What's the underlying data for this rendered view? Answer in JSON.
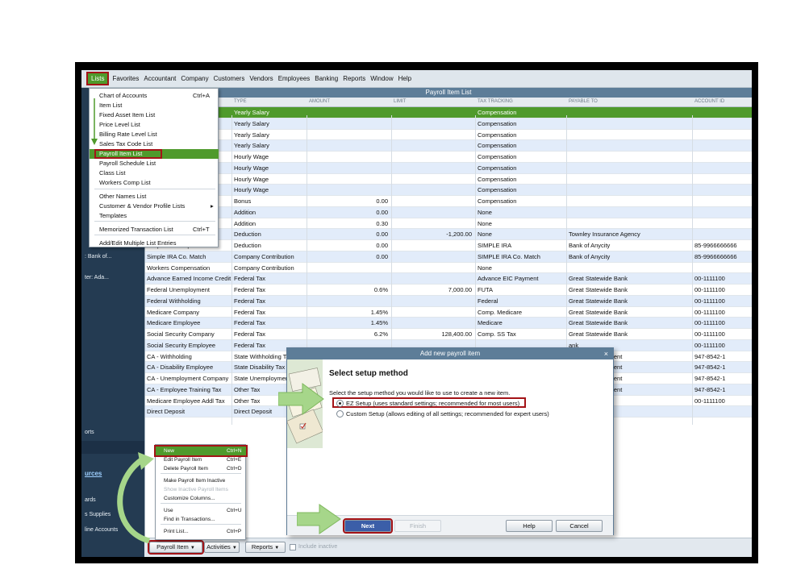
{
  "menubar": [
    "Lists",
    "Favorites",
    "Accountant",
    "Company",
    "Customers",
    "Vendors",
    "Employees",
    "Banking",
    "Reports",
    "Window",
    "Help"
  ],
  "lists_menu": {
    "items": [
      {
        "label": "Chart of Accounts",
        "shortcut": "Ctrl+A"
      },
      {
        "label": "Item List",
        "shortcut": ""
      },
      {
        "label": "Fixed Asset Item List",
        "shortcut": ""
      },
      {
        "label": "Price Level List",
        "shortcut": ""
      },
      {
        "label": "Billing Rate Level List",
        "shortcut": ""
      },
      {
        "label": "Sales Tax Code List",
        "shortcut": ""
      },
      {
        "label": "Payroll Item List",
        "shortcut": ""
      },
      {
        "label": "Payroll Schedule List",
        "shortcut": ""
      },
      {
        "label": "Class List",
        "shortcut": ""
      },
      {
        "label": "Workers Comp List",
        "shortcut": ""
      },
      {
        "label": "Other Names List",
        "shortcut": ""
      },
      {
        "label": "Customer & Vendor Profile Lists",
        "shortcut": ""
      },
      {
        "label": "Templates",
        "shortcut": ""
      },
      {
        "label": "Memorized Transaction List",
        "shortcut": "Ctrl+T"
      },
      {
        "label": "Add/Edit Multiple List Entries",
        "shortcut": ""
      }
    ],
    "submenu_arrow": "▸"
  },
  "nav": {
    "text1": ": Bank of...",
    "text2": "ter: Ada...",
    "text3": "orts",
    "link": "urces",
    "text4": "ards",
    "text5": "s Supplies",
    "text6": "line Accounts"
  },
  "payroll_list": {
    "title": "Payroll Item List",
    "columns": [
      "TYPE",
      "AMOUNT",
      "LIMIT",
      "TAX TRACKING",
      "PAYABLE TO",
      "ACCOUNT ID"
    ],
    "rows": [
      [
        "",
        "Yearly Salary",
        "",
        "",
        "Compensation",
        "",
        ""
      ],
      [
        "",
        "Yearly Salary",
        "",
        "",
        "Compensation",
        "",
        ""
      ],
      [
        "",
        "Yearly Salary",
        "",
        "",
        "Compensation",
        "",
        ""
      ],
      [
        "",
        "Yearly Salary",
        "",
        "",
        "Compensation",
        "",
        ""
      ],
      [
        "",
        "Hourly Wage",
        "",
        "",
        "Compensation",
        "",
        ""
      ],
      [
        "",
        "Hourly Wage",
        "",
        "",
        "Compensation",
        "",
        ""
      ],
      [
        "",
        "Hourly Wage",
        "",
        "",
        "Compensation",
        "",
        ""
      ],
      [
        "",
        "Hourly Wage",
        "",
        "",
        "Compensation",
        "",
        ""
      ],
      [
        "",
        "Bonus",
        "0.00",
        "",
        "Compensation",
        "",
        ""
      ],
      [
        "",
        "Addition",
        "0.00",
        "",
        "None",
        "",
        ""
      ],
      [
        "",
        "Addition",
        "0.30",
        "",
        "None",
        "",
        ""
      ],
      [
        "",
        "Deduction",
        "0.00",
        "-1,200.00",
        "None",
        "Townley Insurance Agency",
        ""
      ],
      [
        "Simple IRA Emp.",
        "Deduction",
        "0.00",
        "",
        "SIMPLE IRA",
        "Bank of Anycity",
        "85-9966666666"
      ],
      [
        "Simple IRA Co. Match",
        "Company Contribution",
        "0.00",
        "",
        "SIMPLE IRA Co. Match",
        "Bank of Anycity",
        "85-9966666666"
      ],
      [
        "Workers Compensation",
        "Company Contribution",
        "",
        "",
        "None",
        "",
        ""
      ],
      [
        "Advance Earned Income Credit",
        "Federal Tax",
        "",
        "",
        "Advance EIC Payment",
        "Great Statewide Bank",
        "00-1111100"
      ],
      [
        "Federal Unemployment",
        "Federal Tax",
        "0.6%",
        "7,000.00",
        "FUTA",
        "Great Statewide Bank",
        "00-1111100"
      ],
      [
        "Federal Withholding",
        "Federal Tax",
        "",
        "",
        "Federal",
        "Great Statewide Bank",
        "00-1111100"
      ],
      [
        "Medicare Company",
        "Federal Tax",
        "1.45%",
        "",
        "Comp. Medicare",
        "Great Statewide Bank",
        "00-1111100"
      ],
      [
        "Medicare Employee",
        "Federal Tax",
        "1.45%",
        "",
        "Medicare",
        "Great Statewide Bank",
        "00-1111100"
      ],
      [
        "Social Security Company",
        "Federal Tax",
        "6.2%",
        "128,400.00",
        "Comp. SS Tax",
        "Great Statewide Bank",
        "00-1111100"
      ],
      [
        "Social Security Employee",
        "Federal Tax",
        "",
        "",
        "",
        "ank",
        "00-1111100"
      ],
      [
        "CA - Withholding",
        "State Withholding Ta",
        "",
        "",
        "",
        "opment Department",
        "947-8542-1"
      ],
      [
        "CA - Disability Employee",
        "State Disability Tax",
        "",
        "",
        "",
        "opment Department",
        "947-8542-1"
      ],
      [
        "CA - Unemployment Company",
        "State Unemploymen",
        "",
        "",
        "",
        "opment Department",
        "947-8542-1"
      ],
      [
        "CA - Employee Training Tax",
        "Other Tax",
        "",
        "",
        "",
        "opment Department",
        "947-8542-1"
      ],
      [
        "Medicare Employee Addl Tax",
        "Other Tax",
        "",
        "",
        "",
        "ank",
        "00-1111100"
      ],
      [
        "Direct Deposit",
        "Direct Deposit",
        "",
        "",
        "",
        "",
        ""
      ]
    ]
  },
  "context_menu": {
    "items": [
      {
        "label": "New",
        "shortcut": "Ctrl+N"
      },
      {
        "label": "Edit Payroll Item",
        "shortcut": "Ctrl+E"
      },
      {
        "label": "Delete Payroll Item",
        "shortcut": "Ctrl+D"
      },
      {
        "label": "Make Payroll Item Inactive",
        "shortcut": ""
      },
      {
        "label": "Show Inactive Payroll Items",
        "shortcut": ""
      },
      {
        "label": "Customize Columns...",
        "shortcut": ""
      },
      {
        "label": "Use",
        "shortcut": "Ctrl+U"
      },
      {
        "label": "Find in Transactions...",
        "shortcut": ""
      },
      {
        "label": "Print List...",
        "shortcut": "Ctrl+P"
      }
    ]
  },
  "bottom_buttons": {
    "payroll_item": "Payroll Item",
    "activities": "Activities",
    "reports": "Reports",
    "caret": "▼",
    "include_inactive": "Include inactive"
  },
  "dialog": {
    "title": "Add new payroll item",
    "close": "×",
    "heading": "Select setup method",
    "instruction": "Select the setup method you would like to use to create a new item.",
    "option_ez": "EZ Setup (uses standard settings; recommended for most users)",
    "option_custom": "Custom Setup (allows editing of all settings; recommended for expert users)",
    "selected": "ez",
    "buttons": {
      "next": "Next",
      "finish": "Finish",
      "help": "Help",
      "cancel": "Cancel"
    }
  },
  "colors": {
    "highlight_green": "#4f9a2c",
    "callout_red": "#a41317",
    "arrow_green": "#a6d68a",
    "title_bar": "#5d7d98"
  }
}
